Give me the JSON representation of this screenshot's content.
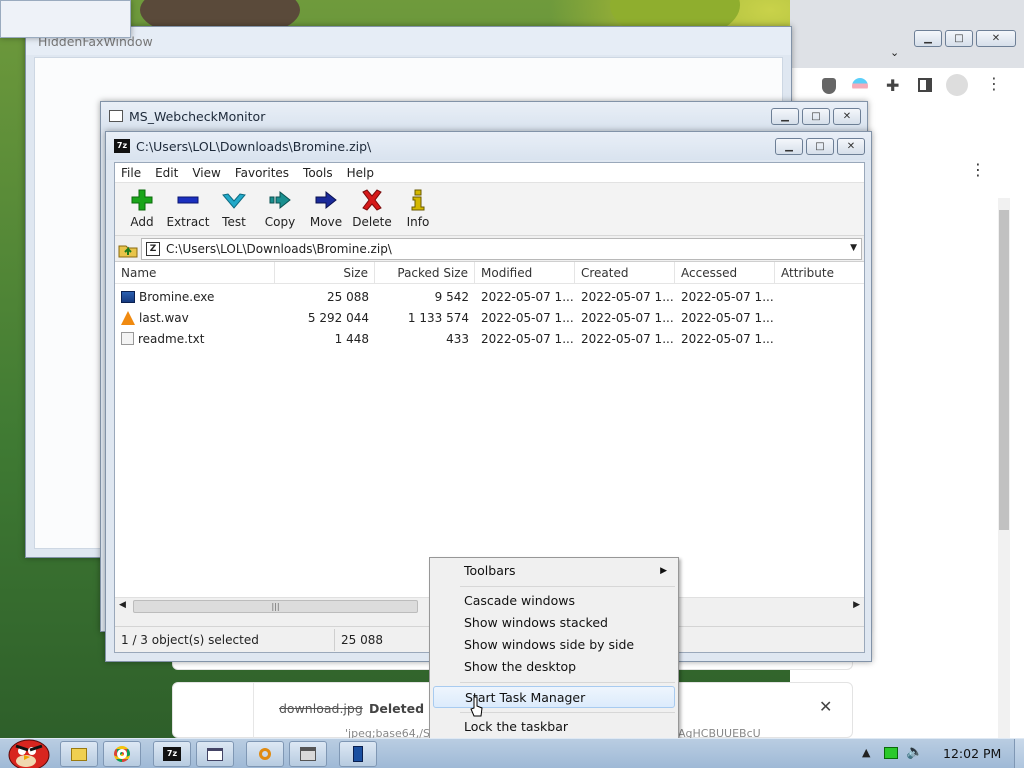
{
  "windows": {
    "fax": {
      "title": "HiddenFaxWindow"
    },
    "webcheck": {
      "title": "MS_WebcheckMonitor"
    },
    "sevenzip": {
      "title": "C:\\Users\\LOL\\Downloads\\Bromine.zip\\"
    }
  },
  "menu": [
    "File",
    "Edit",
    "View",
    "Favorites",
    "Tools",
    "Help"
  ],
  "toolbar": {
    "add": "Add",
    "extract": "Extract",
    "test": "Test",
    "copy": "Copy",
    "move": "Move",
    "delete": "Delete",
    "info": "Info"
  },
  "address": {
    "path": "C:\\Users\\LOL\\Downloads\\Bromine.zip\\"
  },
  "columns": {
    "name": "Name",
    "size": "Size",
    "packed": "Packed Size",
    "modified": "Modified",
    "created": "Created",
    "accessed": "Accessed",
    "attributes": "Attribute"
  },
  "files": [
    {
      "name": "Bromine.exe",
      "size": "25 088",
      "packed": "9 542",
      "modified": "2022-05-07 1...",
      "created": "2022-05-07 1...",
      "accessed": "2022-05-07 1...",
      "icon": "exe-icon"
    },
    {
      "name": "last.wav",
      "size": "5 292 044",
      "packed": "1 133 574",
      "modified": "2022-05-07 1...",
      "created": "2022-05-07 1...",
      "accessed": "2022-05-07 1...",
      "icon": "vlc-cone-icon"
    },
    {
      "name": "readme.txt",
      "size": "1 448",
      "packed": "433",
      "modified": "2022-05-07 1...",
      "created": "2022-05-07 1...",
      "accessed": "2022-05-07 1...",
      "icon": "text-file-icon"
    }
  ],
  "status": {
    "selection": "1 / 3 object(s) selected",
    "size": "25 088"
  },
  "context_menu": {
    "toolbars": "Toolbars",
    "cascade": "Cascade windows",
    "stacked": "Show windows stacked",
    "side_by_side": "Show windows side by side",
    "desktop": "Show the desktop",
    "task_manager": "Start Task Manager",
    "lock": "Lock the taskbar"
  },
  "chrome": {
    "download_name": "download.jpg",
    "download_status": "Deleted",
    "download_url": "'jpeg;base64,/S",
    "download_url_tail": "AgHCBUUEBcU"
  },
  "taskbar": {
    "time": "12:02 PM"
  },
  "colors": {
    "add": "#1aa51a",
    "extract": "#1a2fbf",
    "test": "#22a9c9",
    "copy": "#1a8f8f",
    "move": "#1a2a9a",
    "delete": "#d61a1a",
    "info": "#d4b800"
  }
}
